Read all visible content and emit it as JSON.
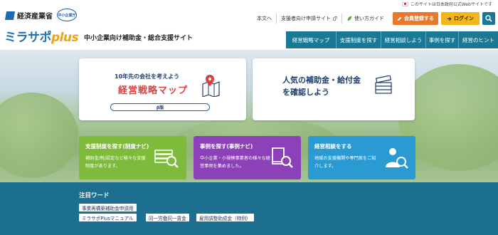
{
  "gov_notice": "このサイトは日本政府公式Webサイトです",
  "header": {
    "ministry": "経済産業省",
    "agency_badge": "中小企業庁",
    "logo_main": "ミラサポ",
    "logo_plus": "plus",
    "tagline": "中小企業向け補助金・総合支援サイト"
  },
  "util": {
    "text_label": "本文へ",
    "support_site": "支援者向け申請サイト",
    "guide": "使い方ガイド",
    "register": "会員登録する",
    "login": "ログイン"
  },
  "nav": [
    "経営戦略マップ",
    "支援制度を探す",
    "経営相談しよう",
    "事例を探す",
    "経営のヒント"
  ],
  "strategy_card": {
    "subtitle": "10年先の会社を考えよう",
    "title": "経営戦略マップ",
    "beta": "β版"
  },
  "popular_card": {
    "line1": "人気の補助金・給付金",
    "line2": "を確認しよう"
  },
  "nav_cards": [
    {
      "title": "支援制度を探す(制度ナビ)",
      "desc": "補助金/税/認定など様々な支援制度があります。"
    },
    {
      "title": "事例を探す(事例ナビ)",
      "desc": "中小企業・小規模事業者の様々な経営事例を集めました。"
    },
    {
      "title": "経営相談をする",
      "desc": "地域の支援機関や専門家をご紹介します。"
    }
  ],
  "keywords": {
    "heading": "注目ワード",
    "tags": [
      "事業再構築補助金申請用",
      "ミラサポPlusマニュアル",
      "同一労働同一賃金",
      "雇用調整助成金（特例）"
    ]
  },
  "colors": {
    "nav_teal": "#1a7a96",
    "register_orange": "#e8792b",
    "login_yellow": "#f2b51c",
    "green_card": "#7fbb3a",
    "purple_card": "#8c41b9",
    "blue_card": "#2a9ad3",
    "footer_band": "#1c6f8f"
  }
}
